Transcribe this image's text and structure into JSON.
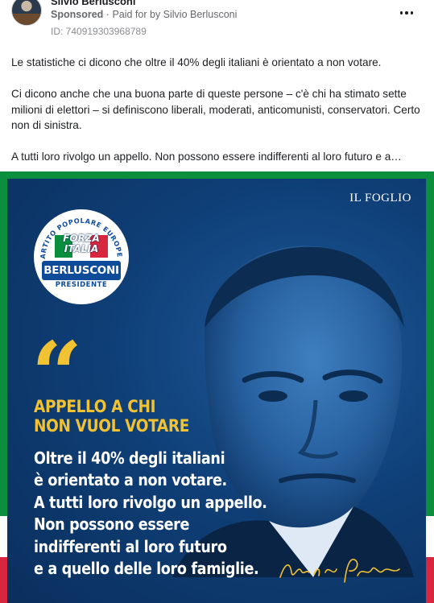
{
  "header": {
    "page_name": "Silvio Berlusconi",
    "sponsored_label": "Sponsored",
    "separator": "·",
    "paid_for_by": "Paid for by Silvio Berlusconi",
    "ad_id": "ID: 740919303968789"
  },
  "post": {
    "paragraphs": [
      "Le statistiche ci dicono che oltre il 40% degli italiani è orientato a non votare.",
      "Ci dicono anche che una buona parte di queste persone – c'è chi ha stimato sette milioni di elettori – si definiscono liberali, moderati, anticomunisti, conservatori. Certo non di sinistra.",
      "A tutti loro rivolgo un appello. Non possono essere indifferenti al loro futuro e a…"
    ]
  },
  "creative": {
    "publisher": "IL FOGLIO",
    "logo": {
      "ring_text": "PARTITO POPOLARE EUROPEO",
      "party_line1": "FORZA",
      "party_line2": "ITALIA",
      "leader": "BERLUSCONI",
      "role": "PRESIDENTE"
    },
    "quote_mark": "“",
    "headline": [
      "APPELLO A CHI",
      "NON VUOL VOTARE"
    ],
    "body_lines": [
      "Oltre il 40% degli italiani",
      "è orientato a non votare.",
      "A tutti loro rivolgo un appello.",
      "Non possono essere",
      "indifferenti al loro futuro",
      "e a quello delle loro famiglie."
    ],
    "signature": "Silvio Berlusconi"
  },
  "colors": {
    "accent_yellow": "#f1c232",
    "background_blue": "#0f3f77",
    "flag_green": "#0b8f3c",
    "flag_red": "#d7263d"
  },
  "icons": {
    "more_options": "more-horizontal-icon"
  }
}
